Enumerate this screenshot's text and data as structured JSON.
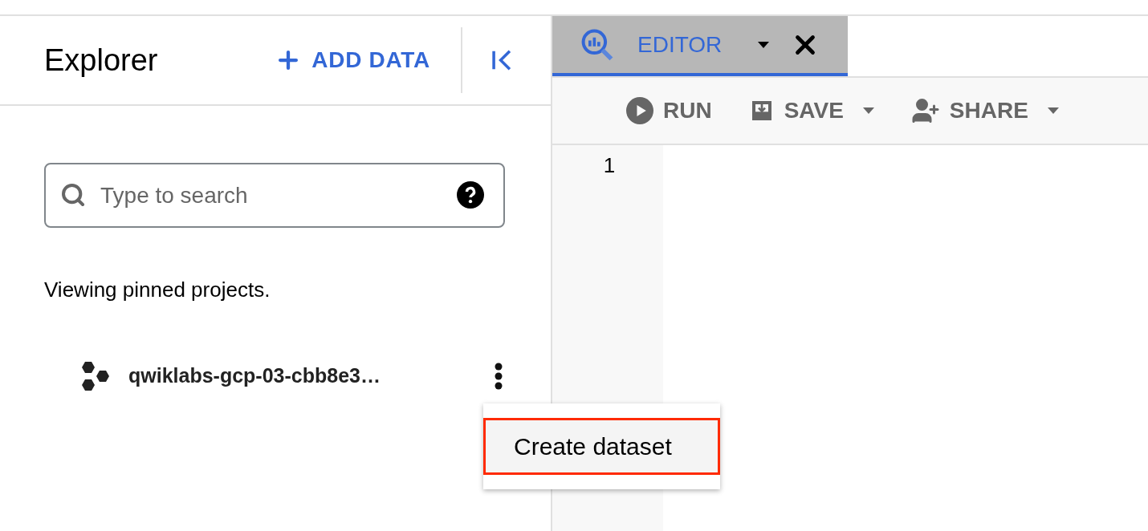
{
  "explorer": {
    "title": "Explorer",
    "add_data": "ADD DATA",
    "search": {
      "placeholder": "Type to search"
    },
    "note": "Viewing pinned projects.",
    "projects": [
      {
        "name": "qwiklabs-gcp-03-cbb8e3…"
      }
    ]
  },
  "context_menu": {
    "items": [
      {
        "label": "Create dataset",
        "highlighted": true
      }
    ]
  },
  "editor": {
    "tabs": [
      {
        "label": "EDITOR",
        "selected": true
      }
    ],
    "toolbar": [
      {
        "kind": "run",
        "label": "RUN",
        "dropdown": false
      },
      {
        "kind": "save",
        "label": "SAVE",
        "dropdown": true
      },
      {
        "kind": "share",
        "label": "SHARE",
        "dropdown": true
      }
    ],
    "line_numbers": [
      "1"
    ]
  }
}
